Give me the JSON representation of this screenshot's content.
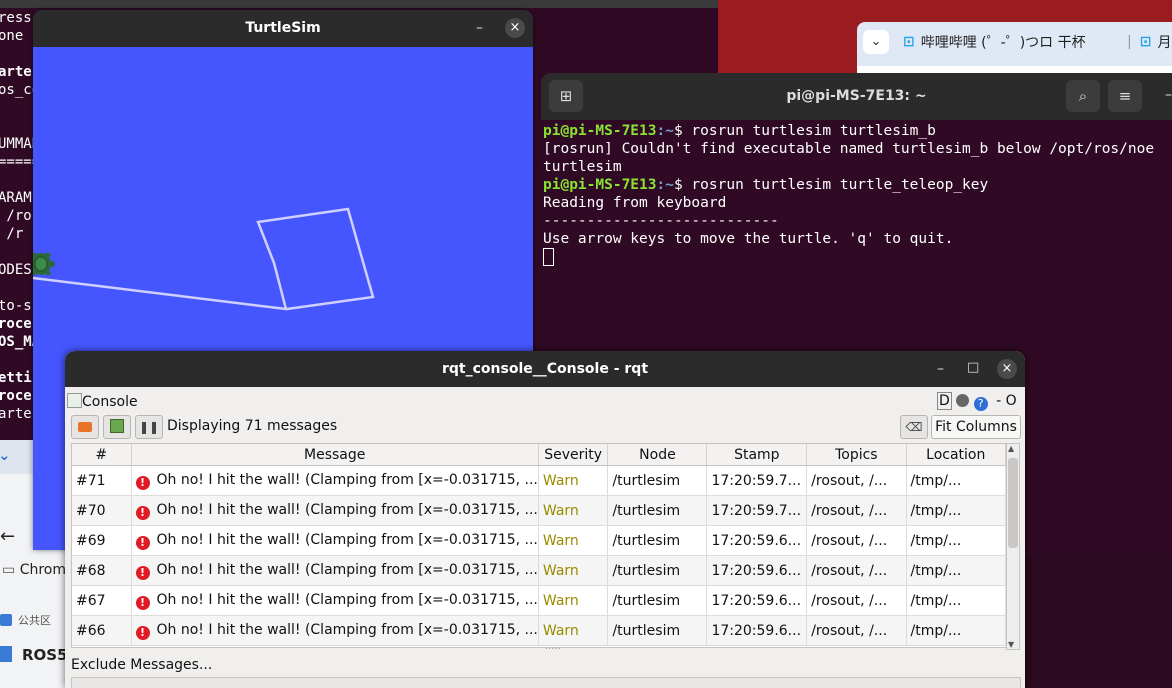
{
  "background_terminal": {
    "lines": [
      {
        "text": "ress",
        "bold": false
      },
      {
        "text": "one c",
        "bold": false
      },
      {
        "text": "",
        "bold": false
      },
      {
        "text": "arte",
        "bold": true
      },
      {
        "text": "os_co",
        "bold": false
      },
      {
        "text": "",
        "bold": false
      },
      {
        "text": "",
        "bold": false
      },
      {
        "text": "UMMAR",
        "bold": false
      },
      {
        "text": "=====",
        "bold": false
      },
      {
        "text": "",
        "bold": false
      },
      {
        "text": "ARAME",
        "bold": false
      },
      {
        "text": " /ro",
        "bold": false
      },
      {
        "text": " /r",
        "bold": false
      },
      {
        "text": "",
        "bold": false
      },
      {
        "text": "ODES",
        "bold": false
      },
      {
        "text": "",
        "bold": false
      },
      {
        "text": "to-s",
        "bold": false
      },
      {
        "text": "roces",
        "bold": true
      },
      {
        "text": "OS_MA",
        "bold": true
      },
      {
        "text": "",
        "bold": false
      },
      {
        "text": "etti",
        "bold": true
      },
      {
        "text": "roces",
        "bold": true
      },
      {
        "text": "arte",
        "bold": false
      }
    ]
  },
  "browser": {
    "tab1": "哔哩哔哩 (゜-゜)つロ 干杯",
    "tab2": "月"
  },
  "left_browser": {
    "items": [
      "Chrom",
      "公共区",
      "ROS5"
    ]
  },
  "turtlesim": {
    "title": "TurtleSim",
    "background_color": "#4556ff",
    "path_color": "#cfd0ff"
  },
  "terminal": {
    "title": "pi@pi-MS-7E13: ~",
    "lines": [
      {
        "prompt": "pi@pi-MS-7E13",
        "suffix": ":~$ ",
        "cmd": "rosrun turtlesim turtlesim_b"
      },
      {
        "text": "[rosrun] Couldn't find executable named turtlesim_b below /opt/ros/noe"
      },
      {
        "text": "turtlesim"
      },
      {
        "prompt": "pi@pi-MS-7E13",
        "suffix": ":~$ ",
        "cmd": "rosrun turtlesim turtle_teleop_key"
      },
      {
        "text": "Reading from keyboard"
      },
      {
        "text": "---------------------------"
      },
      {
        "text": "Use arrow keys to move the turtle. 'q' to quit."
      }
    ]
  },
  "rqt": {
    "title": "rqt_console__Console - rqt",
    "console_label": "Console",
    "right_labels": "D",
    "right_trail": "-  O",
    "displaying": "Displaying 71 messages",
    "fit_columns": "Fit Columns",
    "exclude": "Exclude Messages...",
    "columns": [
      "#",
      "Message",
      "Severity",
      "Node",
      "Stamp",
      "Topics",
      "Location"
    ],
    "rows": [
      {
        "num": "#71",
        "message": "Oh no! I hit the wall! (Clamping from [x=-0.031715, ...",
        "severity": "Warn",
        "node": "/turtlesim",
        "stamp": "17:20:59.7...",
        "topics": "/rosout, /...",
        "location": "/tmp/..."
      },
      {
        "num": "#70",
        "message": "Oh no! I hit the wall! (Clamping from [x=-0.031715, ...",
        "severity": "Warn",
        "node": "/turtlesim",
        "stamp": "17:20:59.7...",
        "topics": "/rosout, /...",
        "location": "/tmp/..."
      },
      {
        "num": "#69",
        "message": "Oh no! I hit the wall! (Clamping from [x=-0.031715, ...",
        "severity": "Warn",
        "node": "/turtlesim",
        "stamp": "17:20:59.6...",
        "topics": "/rosout, /...",
        "location": "/tmp/..."
      },
      {
        "num": "#68",
        "message": "Oh no! I hit the wall! (Clamping from [x=-0.031715, ...",
        "severity": "Warn",
        "node": "/turtlesim",
        "stamp": "17:20:59.6...",
        "topics": "/rosout, /...",
        "location": "/tmp/..."
      },
      {
        "num": "#67",
        "message": "Oh no! I hit the wall! (Clamping from [x=-0.031715, ...",
        "severity": "Warn",
        "node": "/turtlesim",
        "stamp": "17:20:59.6...",
        "topics": "/rosout, /...",
        "location": "/tmp/..."
      },
      {
        "num": "#66",
        "message": "Oh no! I hit the wall! (Clamping from [x=-0.031715, ...",
        "severity": "Warn",
        "node": "/turtlesim",
        "stamp": "17:20:59.6...",
        "topics": "/rosout, /...",
        "location": "/tmp/..."
      }
    ]
  },
  "icons": {
    "close": "×",
    "minimize": "–",
    "maximize": "□",
    "warn": "!",
    "search": "⌕",
    "menu": "≡",
    "chevron": "⌄",
    "back": "←"
  }
}
